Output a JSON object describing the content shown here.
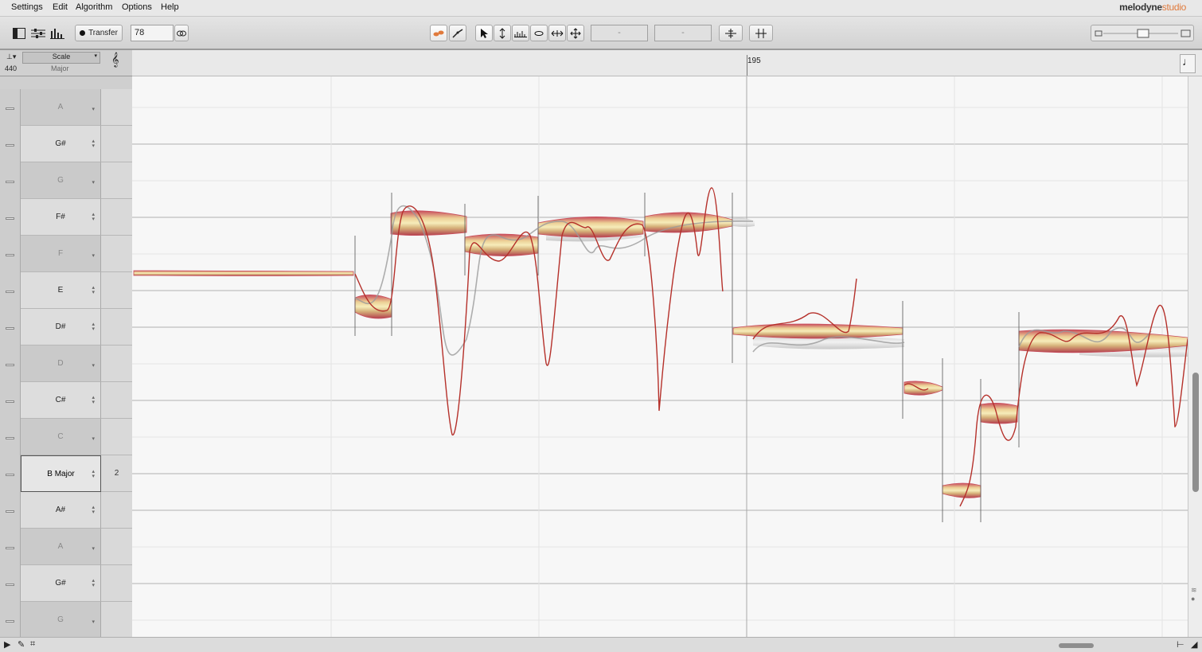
{
  "menu": [
    "Settings",
    "Edit",
    "Algorithm",
    "Options",
    "Help"
  ],
  "app": {
    "name": "melodyne",
    "edition": "studio",
    "accent": "#e07a3c"
  },
  "toolbar": {
    "transfer_label": "Transfer",
    "tempo_value": "78",
    "field_a": "-",
    "field_b": "-",
    "tools": [
      "link-icon",
      "pointer-tool-icon",
      "pitch-tool-icon",
      "formant-tool-icon",
      "amplitude-tool-icon",
      "timing-tool-icon",
      "move-tool-icon"
    ]
  },
  "sidebar": {
    "reference_pitch": "440",
    "scale_label": "Scale",
    "scale_mode": "Major"
  },
  "ruler": {
    "bar_label": "195"
  },
  "keys": [
    {
      "note": "A",
      "in_scale": false,
      "num": ""
    },
    {
      "note": "G#",
      "in_scale": true,
      "num": ""
    },
    {
      "note": "G",
      "in_scale": false,
      "num": ""
    },
    {
      "note": "F#",
      "in_scale": true,
      "num": ""
    },
    {
      "note": "F",
      "in_scale": false,
      "num": ""
    },
    {
      "note": "E",
      "in_scale": true,
      "num": ""
    },
    {
      "note": "D#",
      "in_scale": true,
      "num": ""
    },
    {
      "note": "D",
      "in_scale": false,
      "num": ""
    },
    {
      "note": "C#",
      "in_scale": true,
      "num": ""
    },
    {
      "note": "C",
      "in_scale": false,
      "num": ""
    },
    {
      "note": "B Major",
      "in_scale": true,
      "num": "2",
      "root": true
    },
    {
      "note": "A#",
      "in_scale": true,
      "num": ""
    },
    {
      "note": "A",
      "in_scale": false,
      "num": ""
    },
    {
      "note": "G#",
      "in_scale": true,
      "num": ""
    },
    {
      "note": "G",
      "in_scale": false,
      "num": ""
    }
  ],
  "colors": {
    "blob_core": "#f3e6a6",
    "blob_edge": "#c84c5c",
    "pitch_curve": "#b5302a"
  }
}
